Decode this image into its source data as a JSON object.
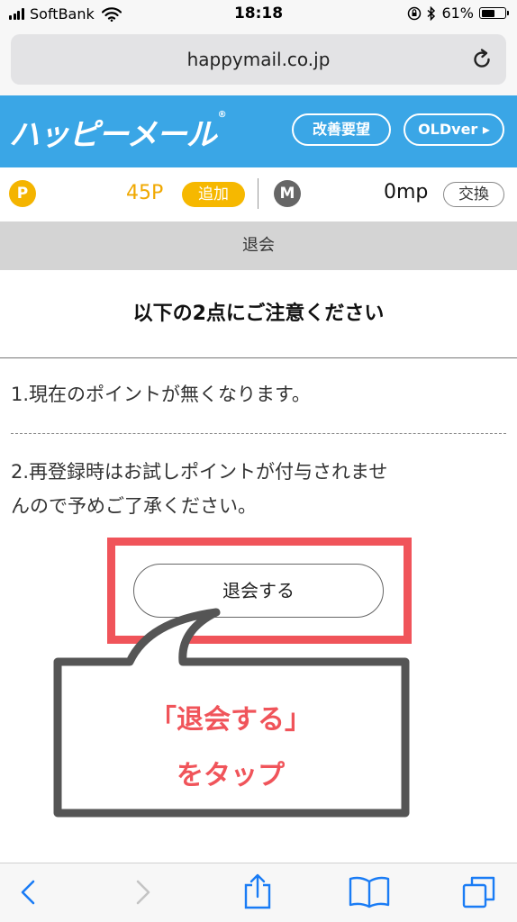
{
  "status_bar": {
    "carrier": "SoftBank",
    "time": "18:18",
    "battery": "61%",
    "battery_level": 0.61
  },
  "browser": {
    "url": "happymail.co.jp"
  },
  "site_header": {
    "logo_text": "ハッピーメール",
    "logo_reg": "®",
    "improve_button": "改善要望",
    "old_version_button": "OLDver ▸"
  },
  "points_bar": {
    "p_icon": "P",
    "points": "45P",
    "add_button": "追加",
    "m_icon": "M",
    "mail_points": "0mp",
    "exchange_button": "交換"
  },
  "section_title": "退会",
  "notice": {
    "title": "以下の2点にご注意ください",
    "item_1": "1.現在のポイントが無くなります。",
    "item_2_line_1": "2.再登録時はお試しポイントが付与されませ",
    "item_2_line_2": "んので予めご了承ください。"
  },
  "withdraw_button": "退会する",
  "annotation": {
    "line_1": "「退会する」",
    "line_2": "をタップ"
  },
  "colors": {
    "header_blue": "#3aa6e6",
    "point_yellow": "#f4b400",
    "highlight_red": "#f0545a",
    "ios_blue": "#1a7cf5"
  },
  "toolbar_icons": [
    "back-icon",
    "forward-icon",
    "share-icon",
    "bookmarks-icon",
    "tabs-icon"
  ]
}
